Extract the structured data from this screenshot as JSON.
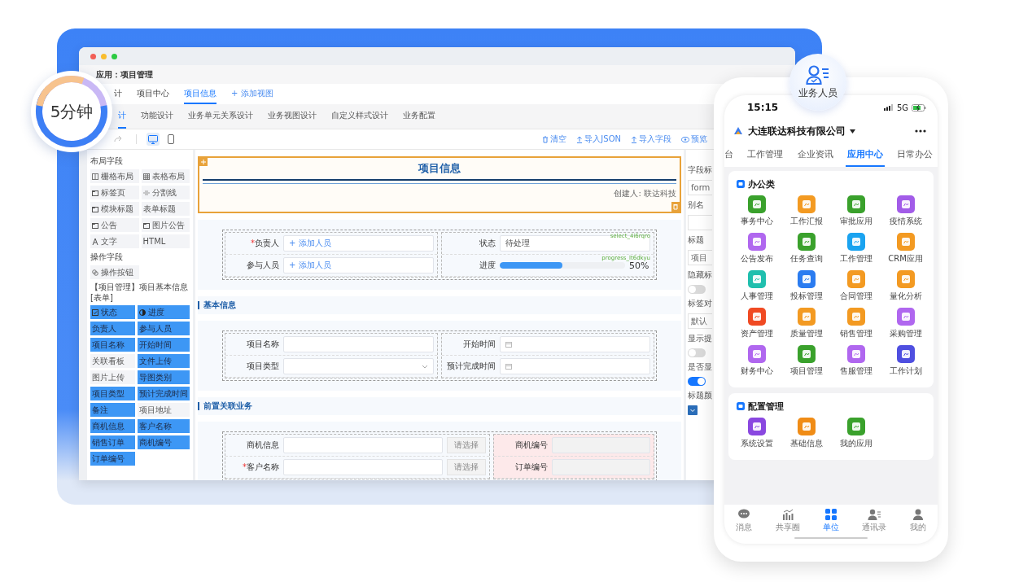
{
  "badge": {
    "text": "5分钟"
  },
  "window": {
    "title": "应用：项目管理"
  },
  "tabs": [
    {
      "label": "计",
      "selected": false,
      "kind": "tab"
    },
    {
      "label": "项目中心",
      "selected": false,
      "kind": "tab"
    },
    {
      "label": "项目信息",
      "selected": true,
      "kind": "tab"
    },
    {
      "label": "+ 添加视图",
      "selected": false,
      "kind": "add"
    }
  ],
  "subtabs": [
    {
      "label": "计",
      "selected": true
    },
    {
      "label": "功能设计",
      "selected": false
    },
    {
      "label": "业务单元关系设计",
      "selected": false
    },
    {
      "label": "业务视图设计",
      "selected": false
    },
    {
      "label": "自定义样式设计",
      "selected": false
    },
    {
      "label": "业务配置",
      "selected": false
    }
  ],
  "devices": [
    {
      "kind": "desktop",
      "selected": true
    },
    {
      "kind": "mobile",
      "selected": false
    }
  ],
  "actions": [
    {
      "kind": "clear",
      "label": "清空"
    },
    {
      "kind": "import",
      "label": "导入JSON"
    },
    {
      "kind": "import",
      "label": "导入字段"
    },
    {
      "kind": "preview",
      "label": "预览"
    }
  ],
  "palette": {
    "layout_heading": "布局字段",
    "layout_items": [
      "栅格布局",
      "表格布局",
      "标签页",
      "分割线",
      "模块标题",
      "表单标题",
      "公告",
      "图片公告",
      "文字",
      "HTML"
    ],
    "action_heading": "操作字段",
    "action_items": [
      "操作按钮"
    ],
    "form_heading": "【项目管理】项目基本信息[表单]",
    "fields": [
      {
        "label": "状态",
        "used": true,
        "kind": "select"
      },
      {
        "label": "进度",
        "used": true,
        "kind": "progress"
      },
      {
        "label": "负责人",
        "used": true,
        "kind": "plain"
      },
      {
        "label": "参与人员",
        "used": true,
        "kind": "plain"
      },
      {
        "label": "项目名称",
        "used": true,
        "kind": "plain"
      },
      {
        "label": "开始时间",
        "used": true,
        "kind": "plain"
      },
      {
        "label": "关联看板",
        "used": false,
        "kind": "plain"
      },
      {
        "label": "文件上传",
        "used": true,
        "kind": "plain"
      },
      {
        "label": "图片上传",
        "used": false,
        "kind": "plain"
      },
      {
        "label": "导图类别",
        "used": true,
        "kind": "plain"
      },
      {
        "label": "项目类型",
        "used": true,
        "kind": "plain"
      },
      {
        "label": "预计完成时间",
        "used": true,
        "kind": "plain"
      },
      {
        "label": "备注",
        "used": true,
        "kind": "plain"
      },
      {
        "label": "项目地址",
        "used": false,
        "kind": "plain"
      },
      {
        "label": "商机信息",
        "used": true,
        "kind": "plain"
      },
      {
        "label": "客户名称",
        "used": true,
        "kind": "plain"
      },
      {
        "label": "销售订单",
        "used": true,
        "kind": "plain"
      },
      {
        "label": "商机编号",
        "used": true,
        "kind": "plain"
      },
      {
        "label": "订单编号",
        "used": true,
        "kind": "plain"
      }
    ]
  },
  "canvas": {
    "header": {
      "title": "项目信息",
      "creator": "创建人: 联达科技",
      "selected": true
    },
    "blocks": [
      {
        "kind": "grid",
        "left": [
          {
            "mark": "*",
            "label": "负责人",
            "kind": "people",
            "value": "+ 添加人员"
          },
          {
            "label": "参与人员",
            "kind": "people",
            "value": "+ 添加人员"
          }
        ],
        "right": [
          {
            "label": "状态",
            "kind": "select",
            "value": "待处理",
            "tag": "select_4i6rqro"
          },
          {
            "label": "进度",
            "kind": "progress",
            "level": 0.5,
            "reading": "50%",
            "tag": "progress_lt6dkyu"
          }
        ]
      },
      {
        "kind": "heading",
        "title": "基本信息"
      },
      {
        "kind": "grid",
        "left": [
          {
            "label": "项目名称",
            "kind": "text"
          },
          {
            "label": "项目类型",
            "kind": "dropdown"
          }
        ],
        "right": [
          {
            "label": "开始时间",
            "kind": "date"
          },
          {
            "label": "预计完成时间",
            "kind": "date"
          }
        ]
      },
      {
        "kind": "heading",
        "title": "前置关联业务"
      },
      {
        "kind": "grid_wide",
        "left": [
          {
            "label": "商机信息",
            "kind": "picker",
            "button": "请选择"
          },
          {
            "mark": "*",
            "label": "客户名称",
            "kind": "picker",
            "button": "请选择"
          }
        ],
        "right": [
          {
            "label": "商机编号",
            "kind": "readonly"
          },
          {
            "label": "订单编号",
            "kind": "readonly"
          }
        ]
      }
    ]
  },
  "props": [
    {
      "kind": "label",
      "text": "字段标"
    },
    {
      "kind": "input",
      "text": "form"
    },
    {
      "kind": "label",
      "text": "别名"
    },
    {
      "kind": "input"
    },
    {
      "kind": "label",
      "text": "标题"
    },
    {
      "kind": "input",
      "text": "项目"
    },
    {
      "kind": "label",
      "text": "隐藏标"
    },
    {
      "kind": "switch",
      "on": false
    },
    {
      "kind": "label",
      "text": "标签对"
    },
    {
      "kind": "input",
      "text": "默认"
    },
    {
      "kind": "label",
      "text": "显示提"
    },
    {
      "kind": "switch",
      "on": false
    },
    {
      "kind": "label",
      "text": "是否显"
    },
    {
      "kind": "switch",
      "on": true
    },
    {
      "kind": "label",
      "text": "标题颜"
    },
    {
      "kind": "color"
    }
  ],
  "role_badge": {
    "text": "业务人员"
  },
  "phone": {
    "time": "15:15",
    "network": "5G",
    "org": "大连联达科技有限公司",
    "tabs": [
      {
        "label": "台",
        "selected": false
      },
      {
        "label": "工作管理",
        "selected": false
      },
      {
        "label": "企业资讯",
        "selected": false
      },
      {
        "label": "应用中心",
        "selected": true
      },
      {
        "label": "日常办公",
        "selected": false
      }
    ],
    "groups": [
      {
        "title": "办公类",
        "apps": [
          {
            "label": "事务中心",
            "color": "#3aa12c"
          },
          {
            "label": "工作汇报",
            "color": "#f39a22"
          },
          {
            "label": "审批应用",
            "color": "#3aa12c"
          },
          {
            "label": "疫情系统",
            "color": "#a25ce8"
          },
          {
            "label": "公告发布",
            "color": "#b067ef"
          },
          {
            "label": "任务查询",
            "color": "#3aa12c"
          },
          {
            "label": "工作管理",
            "color": "#1aa3f0"
          },
          {
            "label": "CRM应用",
            "color": "#f39a22"
          },
          {
            "label": "人事管理",
            "color": "#20bfae"
          },
          {
            "label": "投标管理",
            "color": "#2b7cf0"
          },
          {
            "label": "合同管理",
            "color": "#f39a22"
          },
          {
            "label": "量化分析",
            "color": "#f39a22"
          },
          {
            "label": "资产管理",
            "color": "#f04a23"
          },
          {
            "label": "质量管理",
            "color": "#f39a22"
          },
          {
            "label": "销售管理",
            "color": "#f39a22"
          },
          {
            "label": "采购管理",
            "color": "#b067ef"
          },
          {
            "label": "财务中心",
            "color": "#b067ef"
          },
          {
            "label": "项目管理",
            "color": "#3aa12c"
          },
          {
            "label": "售服管理",
            "color": "#b067ef"
          },
          {
            "label": "工作计划",
            "color": "#4f4fe0"
          }
        ]
      },
      {
        "title": "配置管理",
        "apps": [
          {
            "label": "系统设置",
            "color": "#8a48e0"
          },
          {
            "label": "基础信息",
            "color": "#f08c16"
          },
          {
            "label": "我的应用",
            "color": "#3aa12c"
          }
        ]
      }
    ],
    "nav": [
      {
        "kind": "chat",
        "label": "消息",
        "selected": false
      },
      {
        "kind": "chart",
        "label": "共享圈",
        "selected": false
      },
      {
        "kind": "grid",
        "label": "单位",
        "selected": true
      },
      {
        "kind": "contacts",
        "label": "通讯录",
        "selected": false
      },
      {
        "kind": "person",
        "label": "我的",
        "selected": false
      }
    ]
  }
}
